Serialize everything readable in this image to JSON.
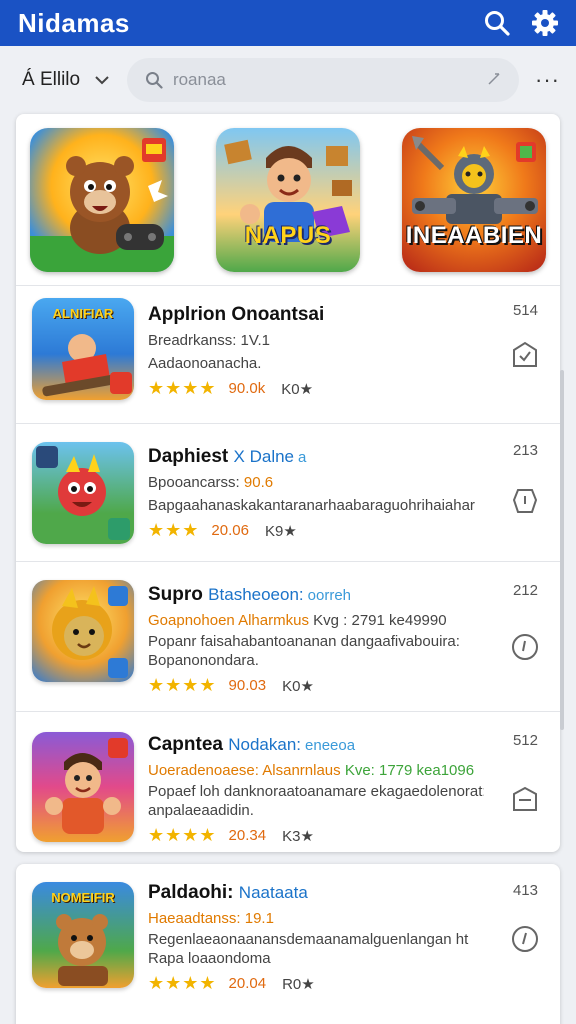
{
  "appbar": {
    "title": "Nidamas"
  },
  "filter": {
    "label": "Á Ellilo"
  },
  "search": {
    "placeholder": "roanaa"
  },
  "more": {
    "label": "···"
  },
  "featured": [
    {
      "label": ""
    },
    {
      "label": "NAPUS"
    },
    {
      "label": "INEAABIEN"
    }
  ],
  "apps": [
    {
      "title": "Applrion Onoantsai",
      "title_tag": "",
      "title_sub": "",
      "line1": "Breadrkanss: 1V.1",
      "line1_hl": "",
      "line2": "Aadaonoanacha.",
      "line3": "",
      "count": "90.0k",
      "rating": "K0★",
      "side_num": "514",
      "thumb_label": "ALNIFIAR"
    },
    {
      "title": "Daphiest",
      "title_tag": "X Dalne",
      "title_sub": "a",
      "line1": "Bpooancarss:",
      "line1_hl": "90.6",
      "line2": "Bapgaahanaskakantaranarhaabaraguohrihaiahar",
      "line3": "",
      "count": "20.06",
      "rating": "K9★",
      "side_num": "213",
      "thumb_label": ""
    },
    {
      "title": "Supro",
      "title_tag": "Btasheoeon:",
      "title_sub": "oorreh",
      "line1": "Goapnohoen Alharmkus",
      "line1_hl": "Kvg : 2791 ke49990",
      "line2": "Popanr faisahabantoananan dangaafivabouira:",
      "line3": "Bopanonondara.",
      "count": "90.03",
      "rating": "K0★",
      "side_num": "212",
      "thumb_label": ""
    },
    {
      "title": "Capntea",
      "title_tag": "Nodakan:",
      "title_sub": "eneeoa",
      "line1": "Uoeradenoaese: Alsanrnlaus",
      "line1_hl": "Kve: 1779 kea1096",
      "line2": "Popaef loh danknoraatoanamare ekagaedolenorat:",
      "line3": "anpalaeaadidin.",
      "count": "20.34",
      "rating": "K3★",
      "side_num": "512",
      "thumb_label": ""
    },
    {
      "title": "Paldaohi:",
      "title_tag": "Naataata",
      "title_sub": "",
      "line1": "Haeaadtanss: 19.1",
      "line1_hl": "",
      "line2": "Regenlaeaonaanansdemaanamalguenlangan ht",
      "line3": "Rapa loaaondoma",
      "count": "20.04",
      "rating": "R0★",
      "side_num": "413",
      "thumb_label": "NOMEIFIR"
    }
  ],
  "stars": "★★★★",
  "stars_partial": "★★★",
  "colors": {
    "appbar": "#1a52c4",
    "accent": "#1b73c9",
    "star": "#f2b400",
    "count": "#e06a10"
  }
}
